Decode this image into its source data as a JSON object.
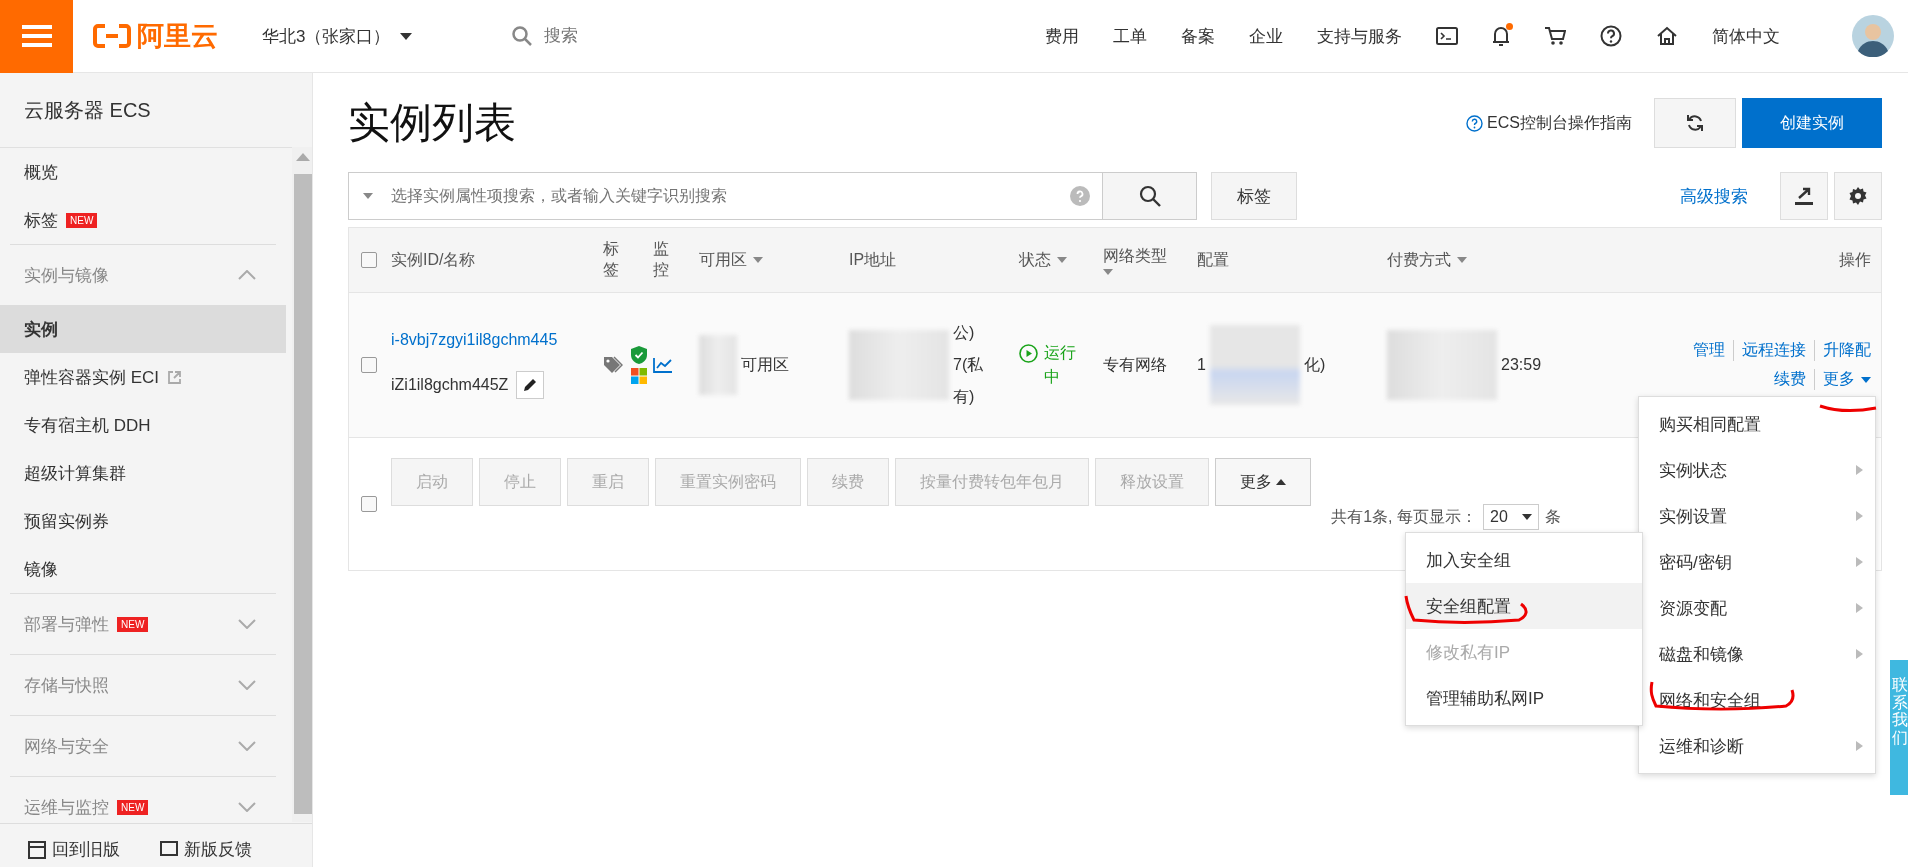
{
  "topbar": {
    "logo": "阿里云",
    "region": "华北3（张家口）",
    "search_placeholder": "搜索",
    "links": [
      "费用",
      "工单",
      "备案",
      "企业",
      "支持与服务"
    ],
    "notification_dot": true,
    "language": "简体中文"
  },
  "sidebar": {
    "title": "云服务器 ECS",
    "items": [
      {
        "kind": "item",
        "label": "概览",
        "selected": false
      },
      {
        "kind": "item",
        "label": "标签",
        "badge": "NEW",
        "selected": false
      },
      {
        "kind": "section",
        "label": "实例与镜像",
        "expanded": true
      },
      {
        "kind": "item",
        "label": "实例",
        "selected": true
      },
      {
        "kind": "item",
        "label": "弹性容器实例 ECI",
        "external": true,
        "selected": false
      },
      {
        "kind": "item",
        "label": "专有宿主机 DDH",
        "selected": false
      },
      {
        "kind": "item",
        "label": "超级计算集群",
        "selected": false
      },
      {
        "kind": "item",
        "label": "预留实例券",
        "selected": false
      },
      {
        "kind": "item",
        "label": "镜像",
        "selected": false
      },
      {
        "kind": "section",
        "label": "部署与弹性",
        "badge": "NEW",
        "expanded": false
      },
      {
        "kind": "section",
        "label": "存储与快照",
        "expanded": false
      },
      {
        "kind": "section",
        "label": "网络与安全",
        "expanded": false
      },
      {
        "kind": "section",
        "label": "运维与监控",
        "badge": "NEW",
        "expanded": false
      }
    ],
    "footer": [
      "回到旧版",
      "新版反馈"
    ]
  },
  "page": {
    "title": "实例列表",
    "guide": "ECS控制台操作指南",
    "create_button": "创建实例",
    "search_placeholder": "选择实例属性项搜索，或者输入关键字识别搜索",
    "tag_button": "标签",
    "advanced_search": "高级搜索"
  },
  "table": {
    "columns": [
      {
        "label": "实例ID/名称",
        "sortable": false
      },
      {
        "label": "标签",
        "sortable": false
      },
      {
        "label": "监控",
        "sortable": false
      },
      {
        "label": "可用区",
        "sortable": true
      },
      {
        "label": "IP地址",
        "sortable": false
      },
      {
        "label": "状态",
        "sortable": true
      },
      {
        "label": "网络类型",
        "sortable": true
      },
      {
        "label": "配置",
        "sortable": false
      },
      {
        "label": "付费方式",
        "sortable": true
      },
      {
        "label": "操作",
        "sortable": false
      }
    ],
    "header_checked": false,
    "bulk_checked": false,
    "rows": [
      {
        "checked": false,
        "id": "i-8vbj7zgyi1il8gchm445",
        "name": "iZi1il8gchm445Z",
        "zone": "可用区",
        "ip": [
          "公)",
          "7(私",
          "有)"
        ],
        "status": "运行中",
        "network": "专有网络",
        "config": [
          "1",
          "化)"
        ],
        "payment": "23:59",
        "actions": [
          "管理",
          "远程连接",
          "升降配",
          "续费",
          "更多"
        ]
      }
    ],
    "bulk_buttons": [
      {
        "label": "启动",
        "disabled": true
      },
      {
        "label": "停止",
        "disabled": true
      },
      {
        "label": "重启",
        "disabled": true
      },
      {
        "label": "重置实例密码",
        "disabled": true
      },
      {
        "label": "续费",
        "disabled": true
      },
      {
        "label": "按量付费转包年包月",
        "disabled": true
      },
      {
        "label": "释放设置",
        "disabled": true
      },
      {
        "label": "更多",
        "disabled": false
      }
    ],
    "pagination": {
      "summary": "共有1条, 每页显示：",
      "page_size": "20",
      "unit": "条"
    }
  },
  "more_menu": [
    {
      "label": "购买相同配置",
      "submenu": false
    },
    {
      "label": "实例状态",
      "submenu": true
    },
    {
      "label": "实例设置",
      "submenu": true
    },
    {
      "label": "密码/密钥",
      "submenu": true
    },
    {
      "label": "资源变配",
      "submenu": true
    },
    {
      "label": "磁盘和镜像",
      "submenu": true
    },
    {
      "label": "网络和安全组",
      "submenu": false
    },
    {
      "label": "运维和诊断",
      "submenu": true
    }
  ],
  "network_submenu": [
    {
      "label": "加入安全组",
      "disabled": false,
      "selected": false
    },
    {
      "label": "安全组配置",
      "disabled": false,
      "selected": true
    },
    {
      "label": "修改私有IP",
      "disabled": true,
      "selected": false
    },
    {
      "label": "管理辅助私网IP",
      "disabled": false,
      "selected": false
    }
  ],
  "contact_tab": "联系我们"
}
